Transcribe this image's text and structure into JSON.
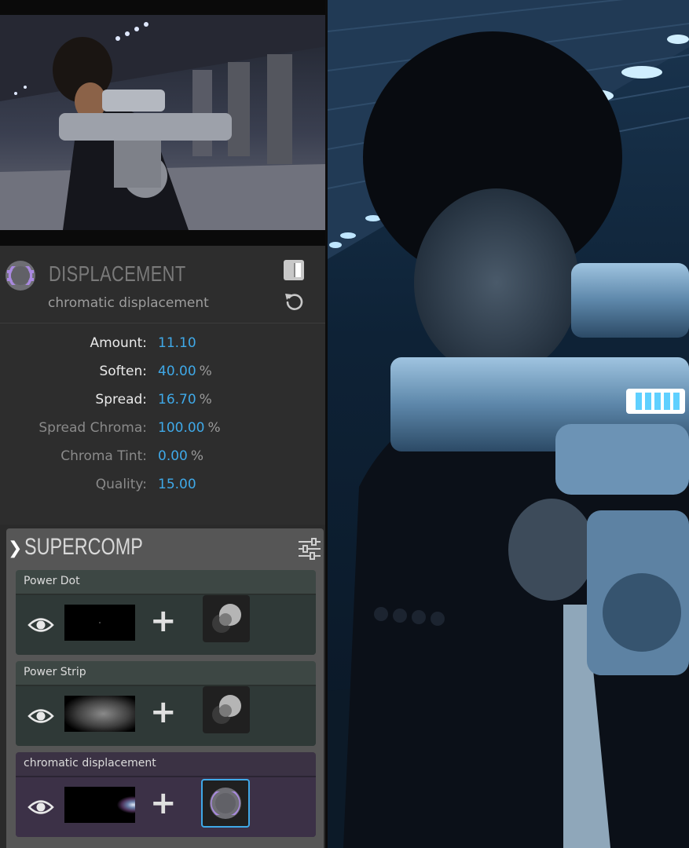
{
  "effect": {
    "title": "DISPLACEMENT",
    "subtitle": "chromatic displacement",
    "params": [
      {
        "label": "Amount:",
        "value": "11.10",
        "unit": "",
        "enabled": true
      },
      {
        "label": "Soften:",
        "value": "40.00",
        "unit": "%",
        "enabled": true
      },
      {
        "label": "Spread:",
        "value": "16.70",
        "unit": "%",
        "enabled": true
      },
      {
        "label": "Spread Chroma:",
        "value": "100.00",
        "unit": "%",
        "enabled": false
      },
      {
        "label": "Chroma Tint:",
        "value": "0.00",
        "unit": "%",
        "enabled": false
      },
      {
        "label": "Quality:",
        "value": "15.00",
        "unit": "",
        "enabled": false
      }
    ]
  },
  "supercomp": {
    "title": "SUPERCOMP",
    "layers": [
      {
        "name": "Power Dot",
        "active": false
      },
      {
        "name": "Power Strip",
        "active": false
      },
      {
        "name": "chromatic displacement",
        "active": true
      }
    ]
  },
  "colors": {
    "value_blue": "#3fa9e8",
    "panel_bg": "#2d2d2d",
    "active_layer": "#3c3147",
    "icon_purple": "#9b7fd0"
  }
}
